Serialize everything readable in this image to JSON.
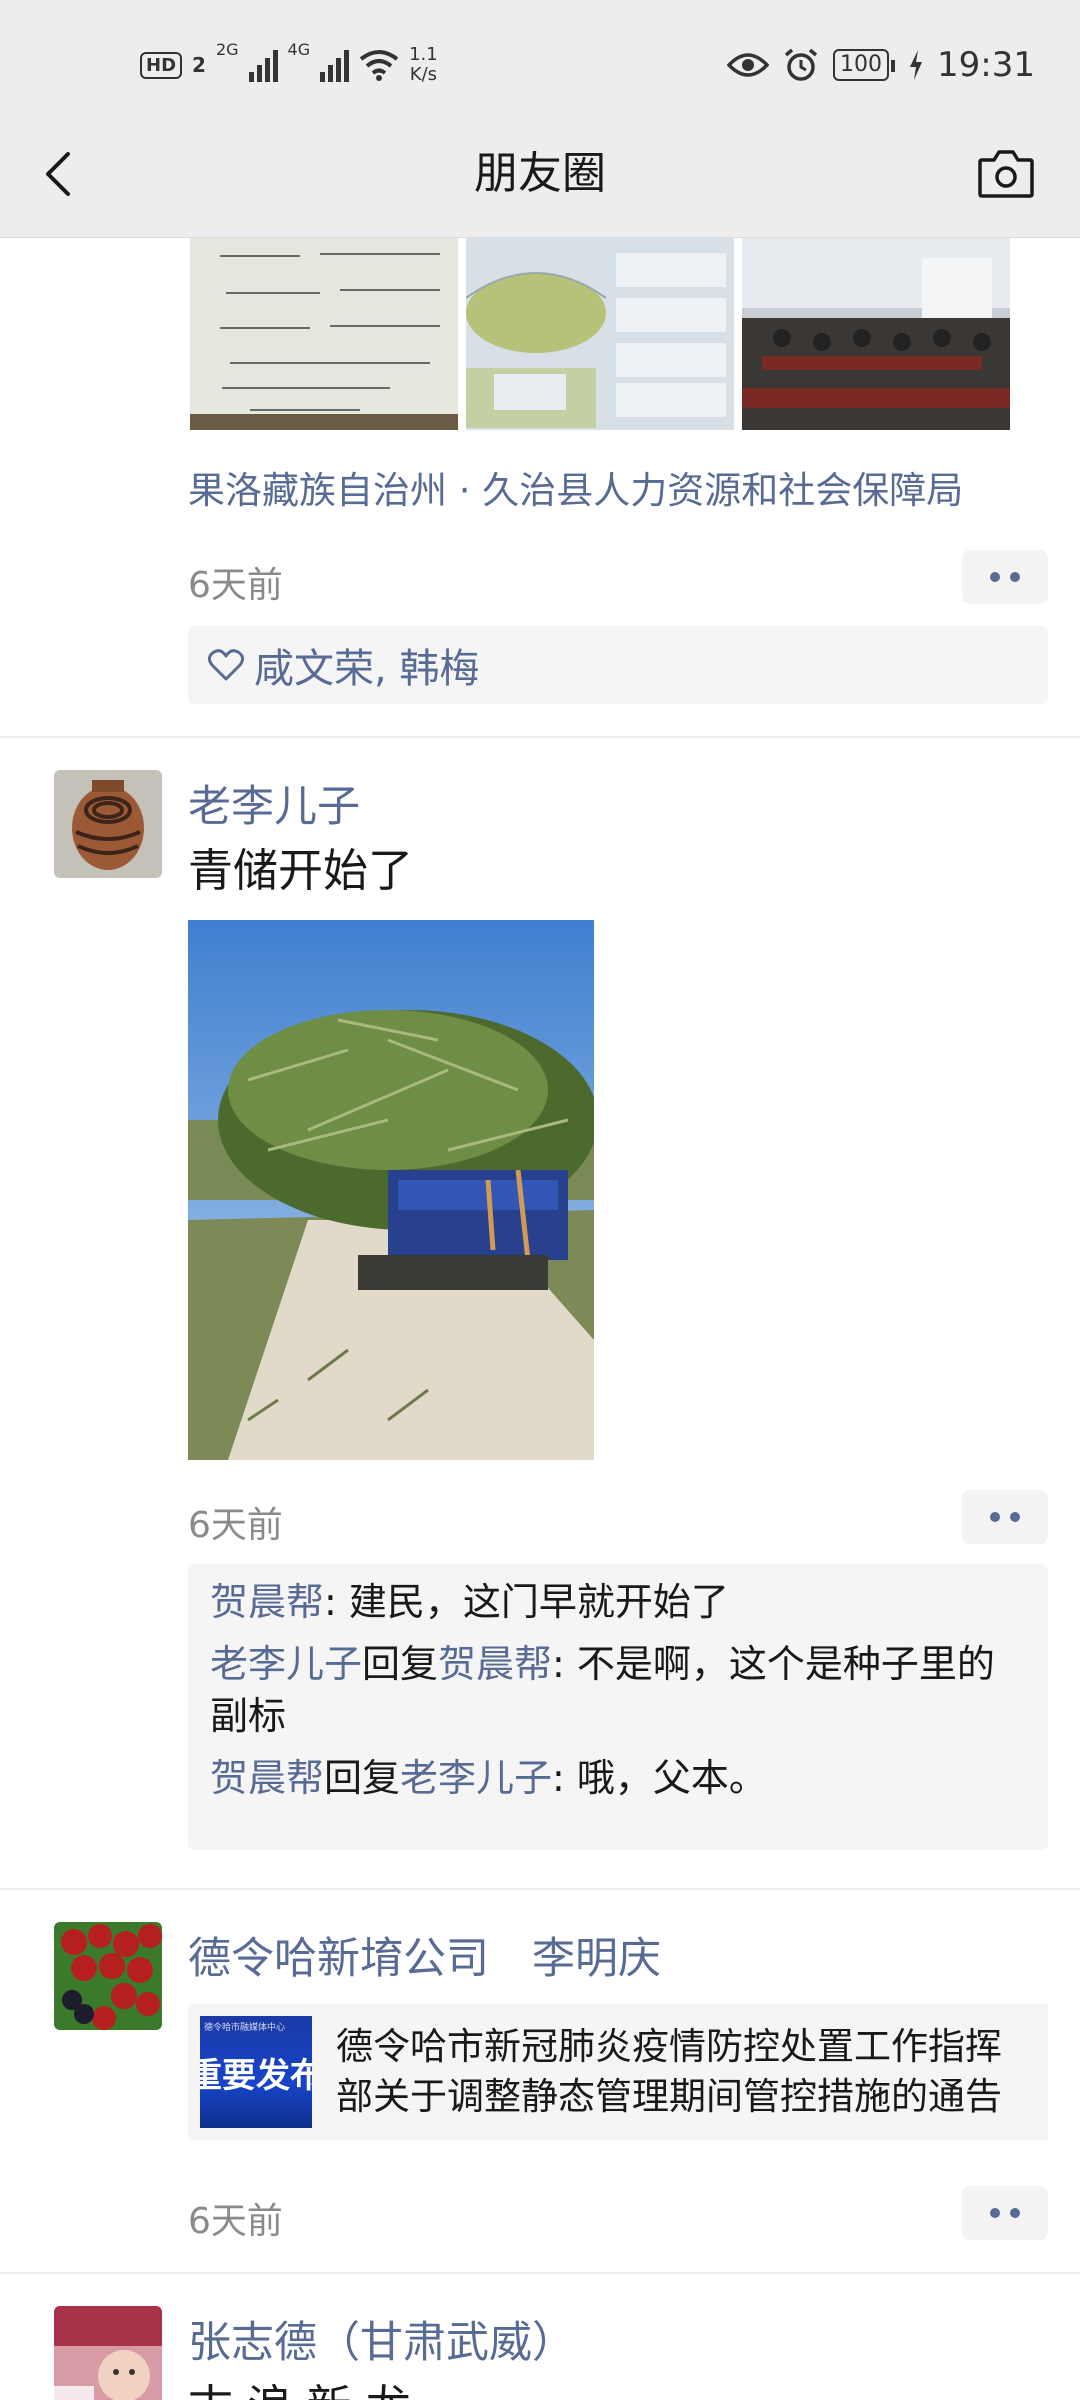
{
  "status_bar": {
    "hd": "HD",
    "sim": "2",
    "net1": "2G",
    "net2": "4G",
    "speed_value": "1.1",
    "speed_unit": "K/s",
    "battery": "100",
    "time": "19:31"
  },
  "nav": {
    "title": "朋友圈"
  },
  "posts": [
    {
      "location": "果洛藏族自治州 · 久治县人力资源和社会保障局",
      "time": "6天前",
      "likes": "咸文荣, 韩梅"
    },
    {
      "user": "老李儿子",
      "text": "青储开始了",
      "time": "6天前",
      "comments": [
        {
          "from": "贺晨帮",
          "to": "",
          "text": ": 建民，这门早就开始了"
        },
        {
          "from": "老李儿子",
          "reply_word": "回复",
          "to": "贺晨帮",
          "text": ": 不是啊，这个是种子里的副标"
        },
        {
          "from": "贺晨帮",
          "reply_word": "回复",
          "to": "老李儿子",
          "text": ": 哦，父本。"
        }
      ]
    },
    {
      "user": "德令哈新堉公司　李明庆",
      "link": {
        "thumb_text": "重要发布",
        "thumb_small": "德令哈市融媒体中心",
        "line1": "德令哈市新冠肺炎疫情防控处置工作指挥",
        "line2": "部关于调整静态管理期间管控措施的通告"
      },
      "time": "6天前"
    },
    {
      "user": "张志德（甘肃武威）",
      "text": "古 浪 新 龙"
    }
  ]
}
